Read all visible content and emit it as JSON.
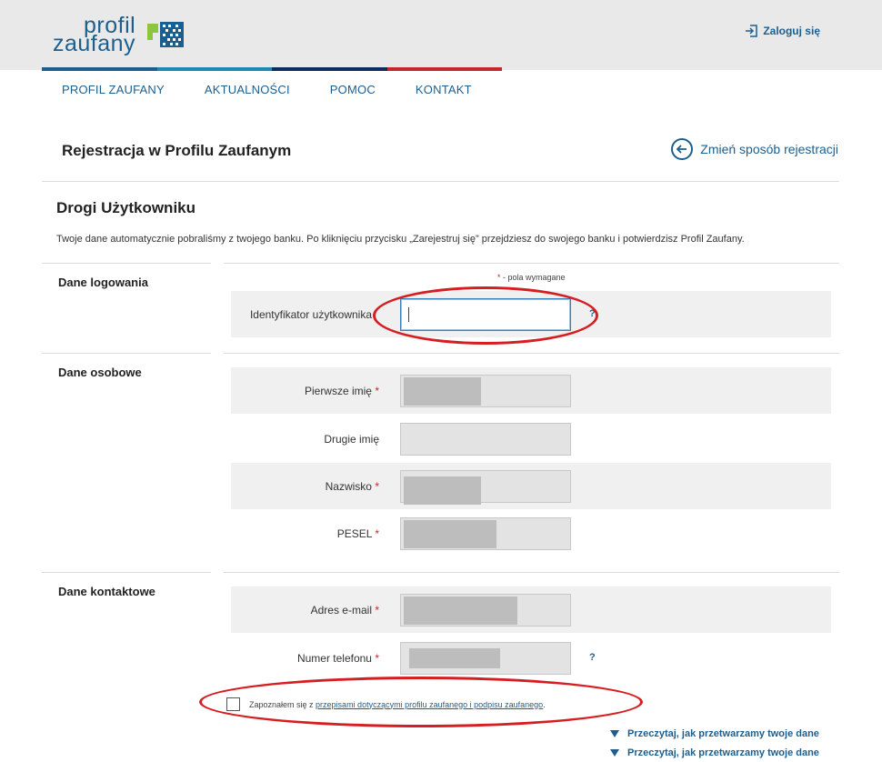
{
  "header": {
    "logo_line1": "profil",
    "logo_line2": "zaufany",
    "login_label": "Zaloguj się",
    "color_stripes": [
      "#1c5f8f",
      "#1d8ab5",
      "#0f2b5b",
      "#c2282e"
    ]
  },
  "nav": {
    "items": [
      "PROFIL ZAUFANY",
      "AKTUALNOŚCI",
      "POMOC",
      "KONTAKT"
    ]
  },
  "page": {
    "title": "Rejestracja w Profilu Zaufanym",
    "change_method": "Zmień sposób rejestracji",
    "greeting": "Drogi Użytkowniku",
    "intro": "Twoje dane automatycznie pobraliśmy z twojego banku. Po kliknięciu przycisku „Zarejestruj się” przejdziesz do swojego banku i potwierdzisz Profil Zaufany."
  },
  "form": {
    "required_star": "*",
    "required_note": " - pola wymagane",
    "sections": {
      "login": "Dane logowania",
      "personal": "Dane osobowe",
      "contact": "Dane kontaktowe"
    },
    "fields": {
      "username": {
        "label": "Identyfikator użytkownika",
        "value": ""
      },
      "first_name": {
        "label": "Pierwsze imię",
        "required": "*"
      },
      "second_name": {
        "label": "Drugie imię"
      },
      "last_name": {
        "label": "Nazwisko",
        "required": "*"
      },
      "pesel": {
        "label": "PESEL",
        "required": "*"
      },
      "email": {
        "label": "Adres e-mail",
        "required": "*"
      },
      "phone": {
        "label": "Numer telefonu",
        "required": "*"
      }
    },
    "help_mark": "?",
    "consent_prefix": "Zapoznałem się z ",
    "consent_link": "przepisami dotyczącymi profilu zaufanego i podpisu zaufanego",
    "consent_suffix": ".",
    "read_more_1": "Przeczytaj, jak przetwarzamy twoje dane",
    "read_more_2": "Przeczytaj, jak przetwarzamy twoje dane"
  },
  "annotation_color": "#d61e22"
}
